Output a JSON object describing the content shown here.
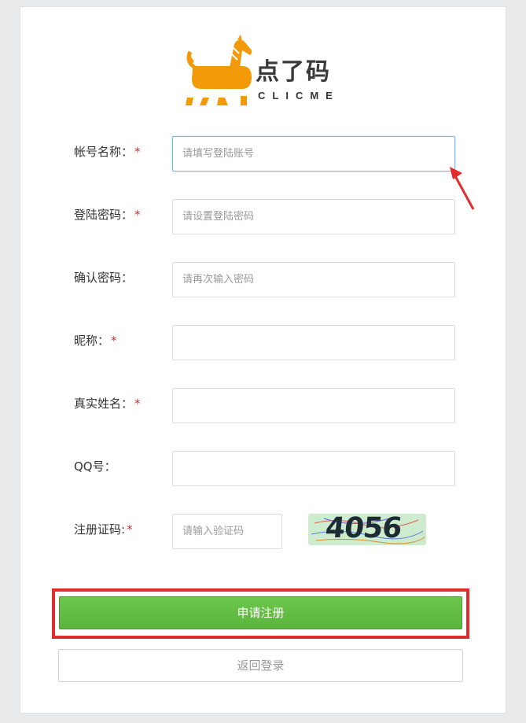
{
  "brand": {
    "name": "点了码",
    "sub": "CLICME",
    "accent": "#f29a0a"
  },
  "form": {
    "account": {
      "label": "帐号名称：",
      "required": "*",
      "placeholder": "请填写登陆账号"
    },
    "password": {
      "label": "登陆密码：",
      "required": "*",
      "placeholder": "请设置登陆密码"
    },
    "confirm": {
      "label": "确认密码：",
      "placeholder": "请再次输入密码"
    },
    "nickname": {
      "label": "昵称：",
      "required": "*",
      "placeholder": ""
    },
    "realname": {
      "label": "真实姓名：",
      "required": "*",
      "placeholder": ""
    },
    "qq": {
      "label": "QQ号：",
      "placeholder": ""
    },
    "code": {
      "label": "注册证码:",
      "required": "*",
      "placeholder": "请输入验证码",
      "captcha": "4056"
    }
  },
  "buttons": {
    "submit": "申请注册",
    "back": "返回登录"
  },
  "colors": {
    "primary": "#5bb53d",
    "required": "#d6303a",
    "highlight": "#e02c2c",
    "focus": "#79b8e6"
  }
}
